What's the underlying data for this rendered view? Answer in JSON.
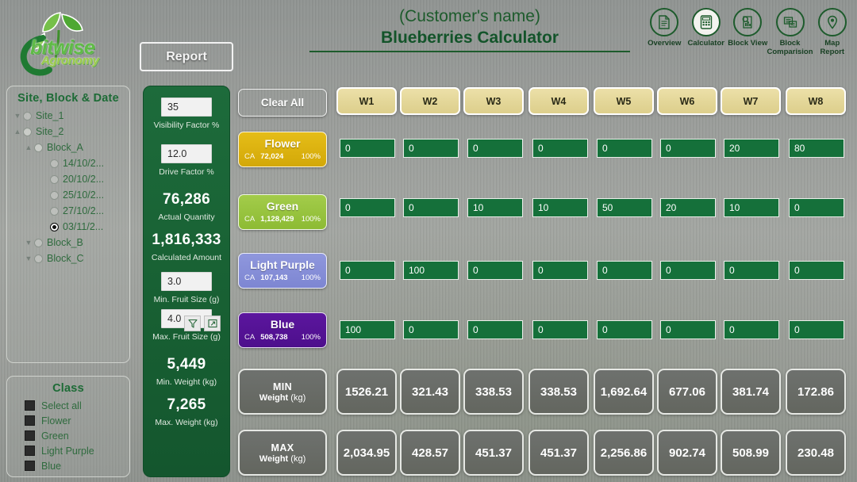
{
  "brand": {
    "name": "bitwise",
    "sub": "Agronomy",
    "icon": "leaf-logo"
  },
  "toolbar": {
    "report_label": "Report"
  },
  "header": {
    "customer_name": "(Customer's name)",
    "title": "Blueberries Calculator"
  },
  "topnav": [
    {
      "label": "Overview",
      "icon": "document-icon",
      "active": false
    },
    {
      "label": "Calculator",
      "icon": "calculator-icon",
      "active": true
    },
    {
      "label": "Block View",
      "icon": "block-view-icon",
      "active": false
    },
    {
      "label": "Block Comparision",
      "icon": "block-comparison-icon",
      "active": false
    },
    {
      "label": "Map Report",
      "icon": "map-pin-icon",
      "active": false
    }
  ],
  "tree_panel": {
    "title": "Site, Block & Date",
    "nodes": [
      {
        "label": "Site_1",
        "indent": 0,
        "chevron": "down",
        "state": "empty"
      },
      {
        "label": "Site_2",
        "indent": 0,
        "chevron": "up",
        "state": "filled"
      },
      {
        "label": "Block_A",
        "indent": 1,
        "chevron": "up",
        "state": "filled"
      },
      {
        "label": "14/10/2...",
        "indent": 2,
        "chevron": "none",
        "state": "empty"
      },
      {
        "label": "20/10/2...",
        "indent": 2,
        "chevron": "none",
        "state": "empty"
      },
      {
        "label": "25/10/2...",
        "indent": 2,
        "chevron": "none",
        "state": "empty"
      },
      {
        "label": "27/10/2...",
        "indent": 2,
        "chevron": "none",
        "state": "empty"
      },
      {
        "label": "03/11/2...",
        "indent": 2,
        "chevron": "none",
        "state": "selected"
      },
      {
        "label": "Block_B",
        "indent": 1,
        "chevron": "down",
        "state": "empty"
      },
      {
        "label": "Block_C",
        "indent": 1,
        "chevron": "down",
        "state": "empty"
      }
    ]
  },
  "class_panel": {
    "title": "Class",
    "items": [
      {
        "label": "Select all"
      },
      {
        "label": "Flower"
      },
      {
        "label": "Green"
      },
      {
        "label": "Light Purple"
      },
      {
        "label": "Blue"
      }
    ]
  },
  "stats": {
    "visibility_factor": {
      "value": "35",
      "caption": "Visibility Factor %"
    },
    "drive_factor": {
      "value": "12.0",
      "caption": "Drive Factor %"
    },
    "actual_quantity": {
      "value": "76,286",
      "caption": "Actual Quantity"
    },
    "calculated_amount": {
      "value": "1,816,333",
      "caption": "Calculated Amount"
    },
    "min_fruit_size": {
      "value": "3.0",
      "caption": "Min. Fruit Size (g)"
    },
    "max_fruit_size": {
      "value": "4.0",
      "caption": "Max. Fruit Size (g)"
    },
    "min_weight": {
      "value": "5,449",
      "caption": "Min. Weight (kg)"
    },
    "max_weight": {
      "value": "7,265",
      "caption": "Max. Weight (kg)"
    },
    "icons": [
      {
        "name": "filter-icon"
      },
      {
        "name": "expand-icon"
      }
    ]
  },
  "clear_all": {
    "label": "Clear All",
    "color": "#1c5230"
  },
  "weeks": [
    "W1",
    "W2",
    "W3",
    "W4",
    "W5",
    "W6",
    "W7",
    "W8"
  ],
  "classes": [
    {
      "name": "Flower",
      "ca_label": "CA",
      "ca_value": "72,024",
      "pct": "100%",
      "color_top": "#e5bd18",
      "color_bot": "#d3a808"
    },
    {
      "name": "Green",
      "ca_label": "CA",
      "ca_value": "1,128,429",
      "pct": "100%",
      "color_top": "#a3cc4a",
      "color_bot": "#8dbb34"
    },
    {
      "name": "Light Purple",
      "ca_label": "CA",
      "ca_value": "107,143",
      "pct": "100%",
      "color_top": "#8f97dd",
      "color_bot": "#7d86d2"
    },
    {
      "name": "Blue",
      "ca_label": "CA",
      "ca_value": "508,738",
      "pct": "100%",
      "color_top": "#5c169e",
      "color_bot": "#4d0f8c"
    }
  ],
  "grid_values": [
    [
      "0",
      "0",
      "0",
      "0",
      "0",
      "0",
      "20",
      "80"
    ],
    [
      "0",
      "0",
      "10",
      "10",
      "50",
      "20",
      "10",
      "0"
    ],
    [
      "0",
      "100",
      "0",
      "0",
      "0",
      "0",
      "0",
      "0"
    ],
    [
      "100",
      "0",
      "0",
      "0",
      "0",
      "0",
      "0",
      "0"
    ]
  ],
  "min_row": {
    "label_line1": "MIN",
    "label_line2_bold": "Weight",
    "label_line2_rest": " (kg)",
    "values": [
      "1526.21",
      "321.43",
      "338.53",
      "338.53",
      "1,692.64",
      "677.06",
      "381.74",
      "172.86"
    ]
  },
  "max_row": {
    "label_line1": "MAX",
    "label_line2_bold": "Weight",
    "label_line2_rest": " (kg)",
    "values": [
      "2,034.95",
      "428.57",
      "451.37",
      "451.37",
      "2,256.86",
      "902.74",
      "508.99",
      "230.48"
    ]
  }
}
